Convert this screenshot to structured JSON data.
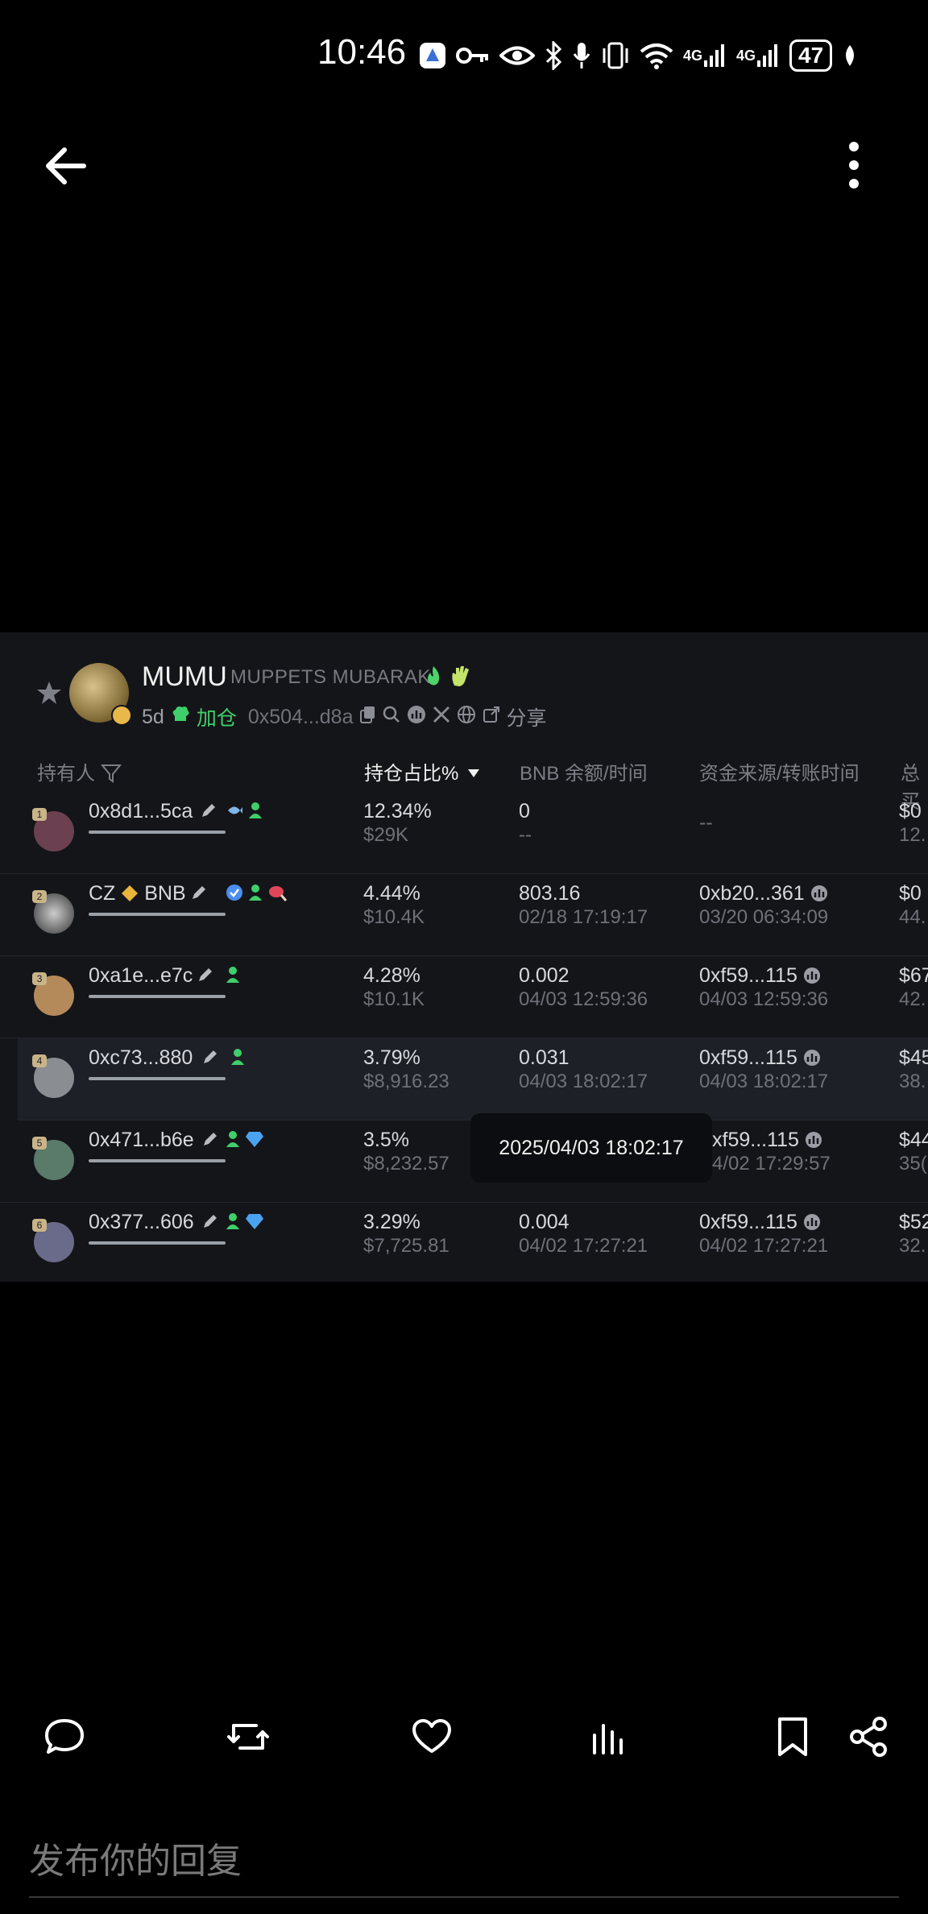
{
  "status_bar": {
    "time": "10:46",
    "network_1": "4G",
    "network_2": "4G",
    "battery": "47",
    "icons": [
      "app-notification-icon",
      "key-icon",
      "eye-icon",
      "bluetooth-icon",
      "mic-icon",
      "vibrate-icon",
      "wifi-icon",
      "signal-icon",
      "signal-icon",
      "battery-icon",
      "leaf-icon"
    ]
  },
  "app_bar": {
    "back_icon": "arrow-left-icon",
    "more_icon": "more-vertical-icon"
  },
  "token": {
    "symbol": "MUMU",
    "name": "MUPPETS MUBARAK",
    "age": "5d",
    "add_position": "加仓",
    "address": "0x504...d8a",
    "share": "分享"
  },
  "table": {
    "headers": {
      "holder": "持有人",
      "percent": "持仓占比%",
      "bnb": "BNB 余额/时间",
      "source": "资金来源/转账时间",
      "total": "总买"
    },
    "rows": [
      {
        "rank": "1",
        "holder": "0x8d1...5ca",
        "percent": "12.34%",
        "usd": "$29K",
        "bnb": "0",
        "bnb_time": "--",
        "source": "--",
        "source_time": "",
        "total": "$0",
        "total_sub": "12."
      },
      {
        "rank": "2",
        "holder": "CZ",
        "holder_suffix": "BNB",
        "percent": "4.44%",
        "usd": "$10.4K",
        "bnb": "803.16",
        "bnb_time": "02/18 17:19:17",
        "source": "0xb20...361",
        "source_time": "03/20 06:34:09",
        "total": "$0",
        "total_sub": "44."
      },
      {
        "rank": "3",
        "holder": "0xa1e...e7c",
        "percent": "4.28%",
        "usd": "$10.1K",
        "bnb": "0.002",
        "bnb_time": "04/03 12:59:36",
        "source": "0xf59...115",
        "source_time": "04/03 12:59:36",
        "total": "$67",
        "total_sub": "42."
      },
      {
        "rank": "4",
        "holder": "0xc73...880",
        "percent": "3.79%",
        "usd": "$8,916.23",
        "bnb": "0.031",
        "bnb_time": "04/03 18:02:17",
        "source": "0xf59...115",
        "source_time": "04/03 18:02:17",
        "total": "$45",
        "total_sub": "38."
      },
      {
        "rank": "5",
        "holder": "0x471...b6e",
        "percent": "3.5%",
        "usd": "$8,232.57",
        "bnb": "",
        "bnb_time": "",
        "source": "xf59...115",
        "source_time": "4/02 17:29:57",
        "total": "$44",
        "total_sub": "35("
      },
      {
        "rank": "6",
        "holder": "0x377...606",
        "percent": "3.29%",
        "usd": "$7,725.81",
        "bnb": "0.004",
        "bnb_time": "04/02 17:27:21",
        "source": "0xf59...115",
        "source_time": "04/02 17:27:21",
        "total": "$52",
        "total_sub": "32."
      }
    ],
    "tooltip": "2025/04/03 18:02:17"
  },
  "actions": [
    "reply-icon",
    "repost-icon",
    "like-icon",
    "views-icon",
    "bookmark-icon",
    "share-icon"
  ],
  "reply": {
    "placeholder": "发布你的回复"
  }
}
